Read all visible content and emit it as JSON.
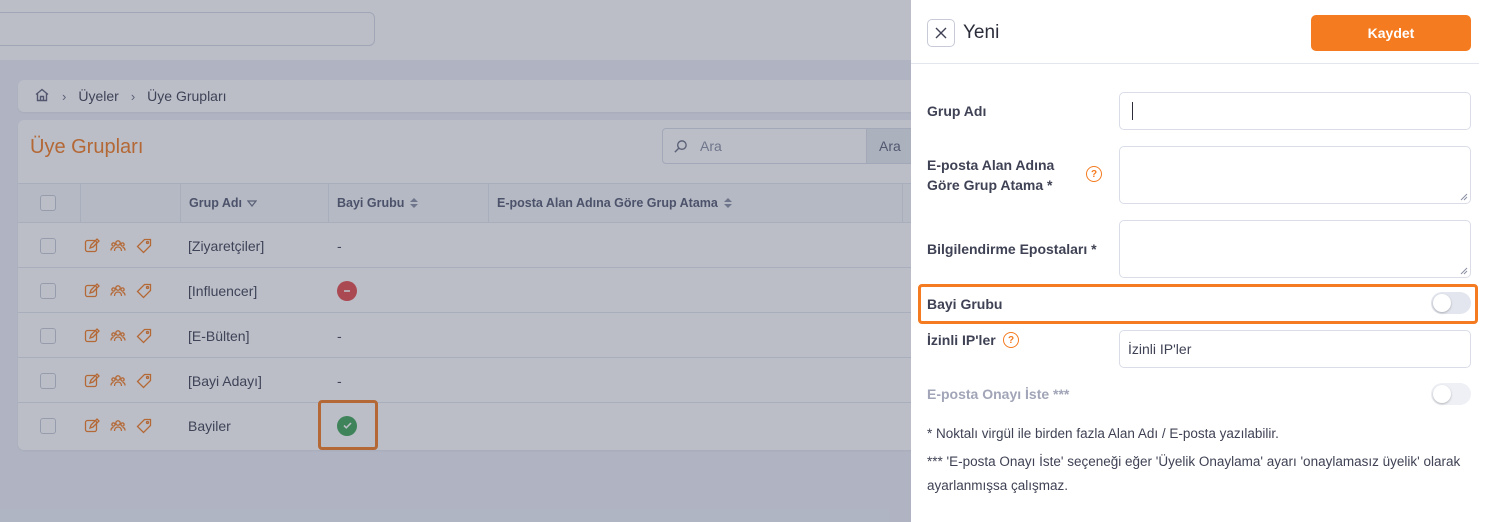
{
  "breadcrumb": {
    "items": [
      "Üyeler",
      "Üye Grupları"
    ]
  },
  "page": {
    "title": "Üye Grupları"
  },
  "table_search": {
    "placeholder": "Ara",
    "button": "Ara"
  },
  "table": {
    "columns": [
      "Grup Adı",
      "Bayi Grubu",
      "E-posta Alan Adına Göre Grup Atama"
    ],
    "rows": [
      {
        "name": "[Ziyaretçiler]",
        "bayi": "-"
      },
      {
        "name": "[Influencer]",
        "bayi": ""
      },
      {
        "name": "[E-Bülten]",
        "bayi": "-"
      },
      {
        "name": "[Bayi Adayı]",
        "bayi": "-"
      },
      {
        "name": "Bayiler",
        "bayi": ""
      }
    ]
  },
  "drawer": {
    "title": "Yeni",
    "save": "Kaydet",
    "fields": {
      "group_name": "Grup Adı",
      "email_domain_line1": "E-posta Alan Adına",
      "email_domain_line2": "Göre Grup Atama *",
      "notification_emails": "Bilgilendirme Epostaları *",
      "dealer_group": "Bayi Grubu",
      "allowed_ips": "İzinli IP'ler",
      "allowed_ips_placeholder": "İzinli IP'ler",
      "email_confirmation": "E-posta Onayı İste ***"
    },
    "notes": {
      "note1": "* Noktalı virgül ile birden fazla Alan Adı / E-posta yazılabilir.",
      "note2": "*** 'E-posta Onayı İste' seçeneği eğer 'Üyelik Onaylama' ayarı 'onaylamasız üyelik' olarak ayarlanmışsa çalışmaz."
    }
  },
  "colors": {
    "accent": "#f47b20",
    "danger": "#e64c4c",
    "success": "#3fa556"
  }
}
